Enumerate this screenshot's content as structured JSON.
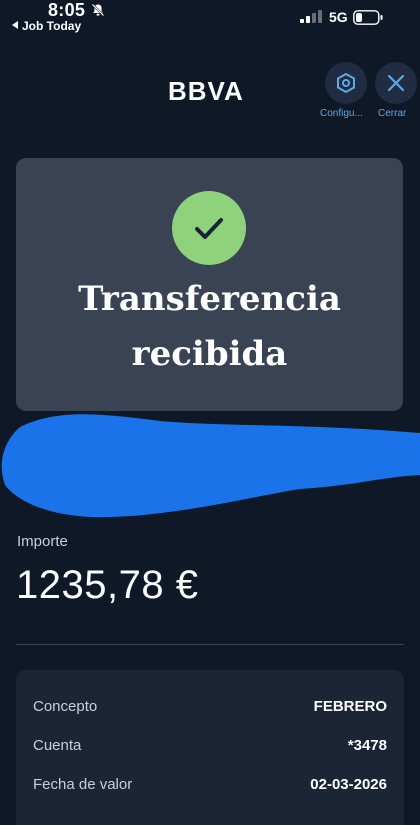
{
  "status_bar": {
    "time": "8:05",
    "back_label": "Job Today",
    "network": "5G"
  },
  "header": {
    "logo": "BBVA",
    "config_label": "Configu...",
    "close_label": "Cerrar"
  },
  "confirmation": {
    "title_line1": "Transferencia",
    "title_line2": "recibida"
  },
  "amount": {
    "label": "Importe",
    "value": "1235,78 €"
  },
  "details": [
    {
      "label": "Concepto",
      "value": "FEBRERO"
    },
    {
      "label": "Cuenta",
      "value": "*3478"
    },
    {
      "label": "Fecha de valor",
      "value": "02-03-2026"
    }
  ],
  "colors": {
    "background": "#0e1827",
    "card": "#3a4354",
    "success": "#8fd27c",
    "link": "#5fa8e6",
    "redaction": "#1a73e8"
  }
}
